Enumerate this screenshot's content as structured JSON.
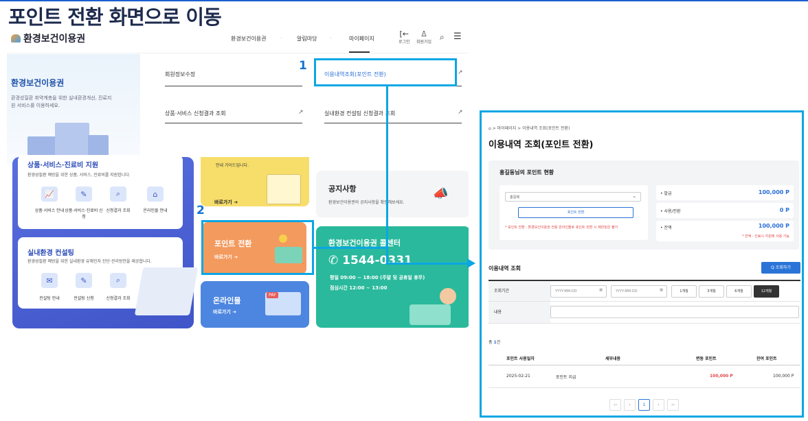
{
  "heading": "포인트 전환 화면으로 이동",
  "site": {
    "logo": "환경보건이용권",
    "nav": [
      "환경보건이용권",
      "알림마당",
      "마이페이지"
    ],
    "icons": [
      {
        "icon": "login-icon",
        "glyph": "[←",
        "label": "로그인"
      },
      {
        "icon": "user-icon",
        "glyph": "ᴥ",
        "label": "회원가입"
      }
    ],
    "hero_title": "환경보건이용권",
    "hero_desc": "환경성질환 취약계층을 위한 실내환경개선, 진료지원 서비스를 이용하세요.",
    "menu": [
      "회원정보수정",
      "이용내역조회(포인트 전환)",
      "상품·서비스 신청결과 조회",
      "실내환경 컨설팅 신청결과 조회"
    ],
    "card1": {
      "title": "상품·서비스·진료비 지원",
      "desc": "환경성질환 예방을 위한 상품, 서비스, 진료비를 지원합니다.",
      "items": [
        "상품·서비스 안내",
        "상품·서비스·진료비 신청",
        "신청결과 조회",
        "온라인몰 안내"
      ]
    },
    "card2": {
      "title": "실내환경 컨설팅",
      "desc": "환경성질환 예방을 위한 실내환경 유해인자 진단·관리방안을 제공합니다.",
      "items": [
        "컨설팅 안내",
        "컨설팅 신청",
        "신청결과 조회"
      ]
    },
    "yellow_desc": "안내 가이드입니다.",
    "go": "바로가기",
    "notice_title": "공지사항",
    "notice_desc": "환경보건이용권의 공지사항을 확인해보세요.",
    "point_title": "포인트 전환",
    "center_title": "환경보건이용권 콜센터",
    "phone": "1544-0331",
    "hours1": "평일 09:00 ~ 18:00 (주말 및 공휴일 휴무)",
    "hours2": "점심시간 12:00 ~ 13:00",
    "mall_title": "온라인몰",
    "pay_badge": "PAY"
  },
  "callouts": {
    "n1": "1",
    "n2": "2"
  },
  "detail": {
    "breadcrumb": "⌂  >  마이페이지  >  이용내역 조회(포인트 전환)",
    "title": "이용내역 조회(포인트 전환)",
    "status_title": "홍길동님의 포인트 현황",
    "select": "홍길제",
    "convert_btn": "포인트 전환",
    "convert_note": "* 포인트 전환 : 환경보건이용권 전용 온라인몰로 포인트 전환 시 제한된은 불가",
    "rows": [
      {
        "label": "• 발급",
        "value": "100,000 P"
      },
      {
        "label": "• 사용/전환",
        "value": "0 P"
      },
      {
        "label": "• 잔액",
        "value": "100,000 P"
      }
    ],
    "balance_note": "* 잔액 : 인료시 지원에 사용 가능",
    "usage_title": "이용내역 조회",
    "search_btn": "Q  조회하기",
    "period_label": "조회기간",
    "date_ph": "YYYY-MM-DD",
    "periods": [
      "1개월",
      "3개월",
      "6개월",
      "12개월"
    ],
    "content_label": "내용",
    "count_prefix": "총 ",
    "count": "1",
    "count_suffix": "건",
    "headers": [
      "포인트 사용일자",
      "세부내용",
      "변동 포인트",
      "잔여 포인트"
    ],
    "row": [
      "2025-02-21",
      "포인트 지급",
      "100,000 P",
      "100,000 P"
    ],
    "pages": [
      "‹‹",
      "‹",
      "1",
      "›",
      "››"
    ]
  },
  "colors": {
    "accent": "#0aa6e4",
    "primary": "#2a74d8",
    "red": "#e04646"
  }
}
